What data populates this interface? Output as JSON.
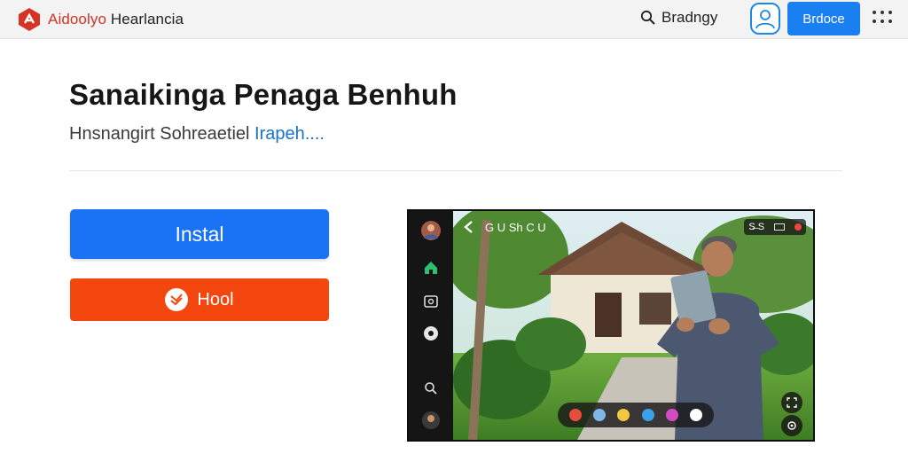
{
  "header": {
    "brand_part1": "Aidoolyo",
    "brand_part2": " Hearlancia",
    "search_label": "Bradngy",
    "primary_button": "Brdoce"
  },
  "main": {
    "title": "Sanaikinga Penaga Benhuh",
    "subtitle_text": "Hnsnangirt Sohreaetiel ",
    "subtitle_link": "Irapeh...."
  },
  "actions": {
    "install_label": "Instal",
    "secondary_label": "Hool"
  },
  "preview": {
    "top_label": "G U Sh C U",
    "top_right_label": "S̶ S",
    "dock_colors": [
      "#e84c3d",
      "#7fb8e6",
      "#f4c542",
      "#3aa0e8",
      "#d64bc4",
      "#ffffff"
    ]
  },
  "colors": {
    "primary": "#1a72f4",
    "secondary": "#f4470f",
    "brand_accent": "#d43325",
    "link": "#1a73c8"
  },
  "icons": {
    "brand": "brand-logo-icon",
    "search": "search-icon",
    "avatar": "user-avatar-icon",
    "more": "more-dots-icon",
    "secondary": "check-badge-icon"
  }
}
